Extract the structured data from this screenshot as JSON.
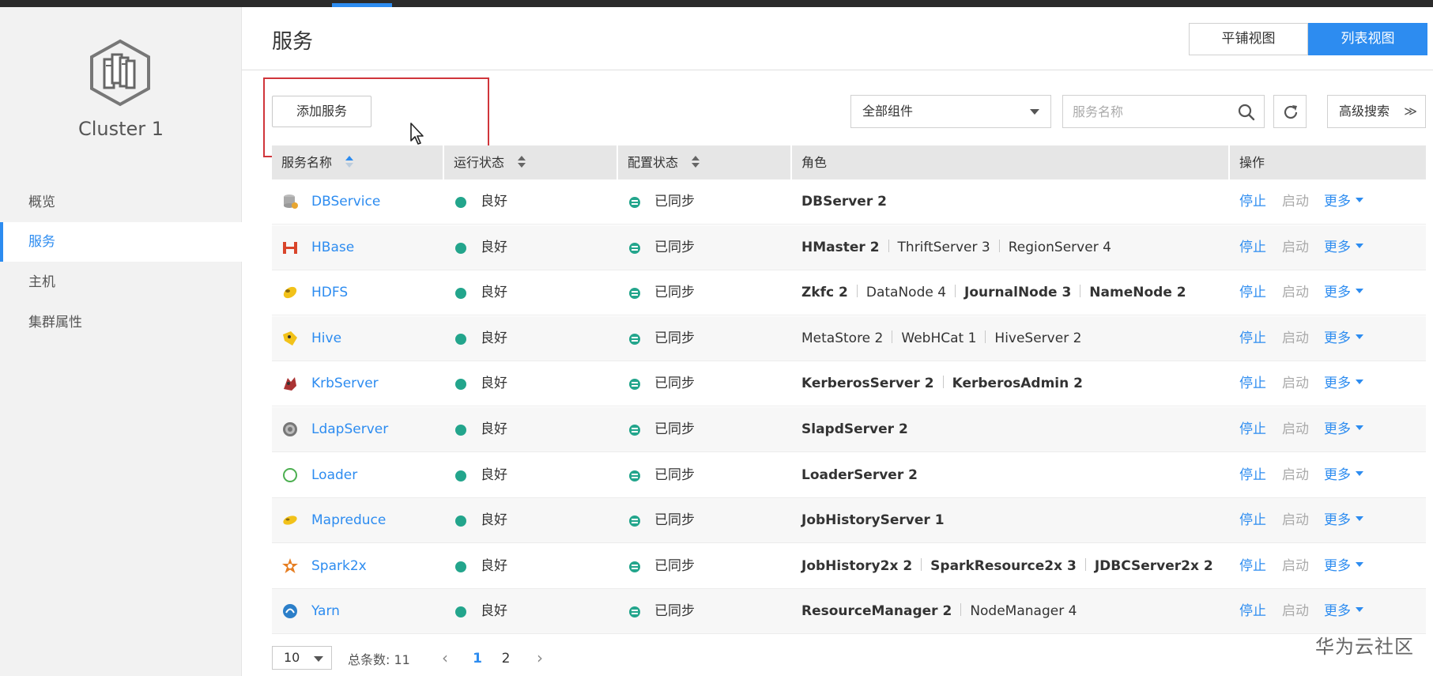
{
  "sidebar": {
    "cluster_name": "Cluster 1",
    "nav": [
      {
        "label": "概览"
      },
      {
        "label": "服务"
      },
      {
        "label": "主机"
      },
      {
        "label": "集群属性"
      }
    ],
    "active_item": "服务"
  },
  "header": {
    "title": "服务",
    "view_toggle": {
      "tile": "平铺视图",
      "list": "列表视图",
      "active": "列表视图"
    }
  },
  "toolbar": {
    "add_service": "添加服务",
    "component_filter": "全部组件",
    "search_placeholder": "服务名称",
    "advanced_search": "高级搜索"
  },
  "table": {
    "columns": [
      "服务名称",
      "运行状态",
      "配置状态",
      "角色",
      "操作"
    ],
    "rows": [
      {
        "name": "DBService",
        "icon": "database-icon",
        "run_status": "良好",
        "config_status": "已同步",
        "roles": [
          {
            "text": "DBServer 2",
            "bold": true
          }
        ],
        "actions": {
          "stop": "停止",
          "start": "启动",
          "more": "更多"
        }
      },
      {
        "name": "HBase",
        "icon": "hbase-icon",
        "run_status": "良好",
        "config_status": "已同步",
        "roles": [
          {
            "text": "HMaster 2",
            "bold": true
          },
          {
            "text": "ThriftServer 3",
            "bold": false
          },
          {
            "text": "RegionServer 4",
            "bold": false
          }
        ],
        "actions": {
          "stop": "停止",
          "start": "启动",
          "more": "更多"
        }
      },
      {
        "name": "HDFS",
        "icon": "hdfs-icon",
        "run_status": "良好",
        "config_status": "已同步",
        "roles": [
          {
            "text": "Zkfc 2",
            "bold": true
          },
          {
            "text": "DataNode 4",
            "bold": false
          },
          {
            "text": "JournalNode 3",
            "bold": true
          },
          {
            "text": "NameNode 2",
            "bold": true
          }
        ],
        "actions": {
          "stop": "停止",
          "start": "启动",
          "more": "更多"
        }
      },
      {
        "name": "Hive",
        "icon": "hive-icon",
        "run_status": "良好",
        "config_status": "已同步",
        "roles": [
          {
            "text": "MetaStore 2",
            "bold": false
          },
          {
            "text": "WebHCat 1",
            "bold": false
          },
          {
            "text": "HiveServer 2",
            "bold": false
          }
        ],
        "actions": {
          "stop": "停止",
          "start": "启动",
          "more": "更多"
        }
      },
      {
        "name": "KrbServer",
        "icon": "kerberos-icon",
        "run_status": "良好",
        "config_status": "已同步",
        "roles": [
          {
            "text": "KerberosServer 2",
            "bold": true
          },
          {
            "text": "KerberosAdmin 2",
            "bold": true
          }
        ],
        "actions": {
          "stop": "停止",
          "start": "启动",
          "more": "更多"
        }
      },
      {
        "name": "LdapServer",
        "icon": "ldap-icon",
        "run_status": "良好",
        "config_status": "已同步",
        "roles": [
          {
            "text": "SlapdServer 2",
            "bold": true
          }
        ],
        "actions": {
          "stop": "停止",
          "start": "启动",
          "more": "更多"
        }
      },
      {
        "name": "Loader",
        "icon": "loader-icon",
        "run_status": "良好",
        "config_status": "已同步",
        "roles": [
          {
            "text": "LoaderServer 2",
            "bold": true
          }
        ],
        "actions": {
          "stop": "停止",
          "start": "启动",
          "more": "更多"
        }
      },
      {
        "name": "Mapreduce",
        "icon": "mapreduce-icon",
        "run_status": "良好",
        "config_status": "已同步",
        "roles": [
          {
            "text": "JobHistoryServer 1",
            "bold": true
          }
        ],
        "actions": {
          "stop": "停止",
          "start": "启动",
          "more": "更多"
        }
      },
      {
        "name": "Spark2x",
        "icon": "spark-icon",
        "run_status": "良好",
        "config_status": "已同步",
        "roles": [
          {
            "text": "JobHistory2x 2",
            "bold": true
          },
          {
            "text": "SparkResource2x 3",
            "bold": true
          },
          {
            "text": "JDBCServer2x 2",
            "bold": true
          }
        ],
        "actions": {
          "stop": "停止",
          "start": "启动",
          "more": "更多"
        }
      },
      {
        "name": "Yarn",
        "icon": "yarn-icon",
        "run_status": "良好",
        "config_status": "已同步",
        "roles": [
          {
            "text": "ResourceManager 2",
            "bold": true
          },
          {
            "text": "NodeManager 4",
            "bold": false
          }
        ],
        "actions": {
          "stop": "停止",
          "start": "启动",
          "more": "更多"
        }
      }
    ]
  },
  "pagination": {
    "page_size": "10",
    "total_label": "总条数: 11",
    "pages": [
      "1",
      "2"
    ],
    "current_page": "1"
  },
  "watermark": "华为云社区",
  "colors": {
    "accent": "#2d8cf0",
    "status_good": "#23a58c",
    "highlight_box": "#d0353b"
  }
}
